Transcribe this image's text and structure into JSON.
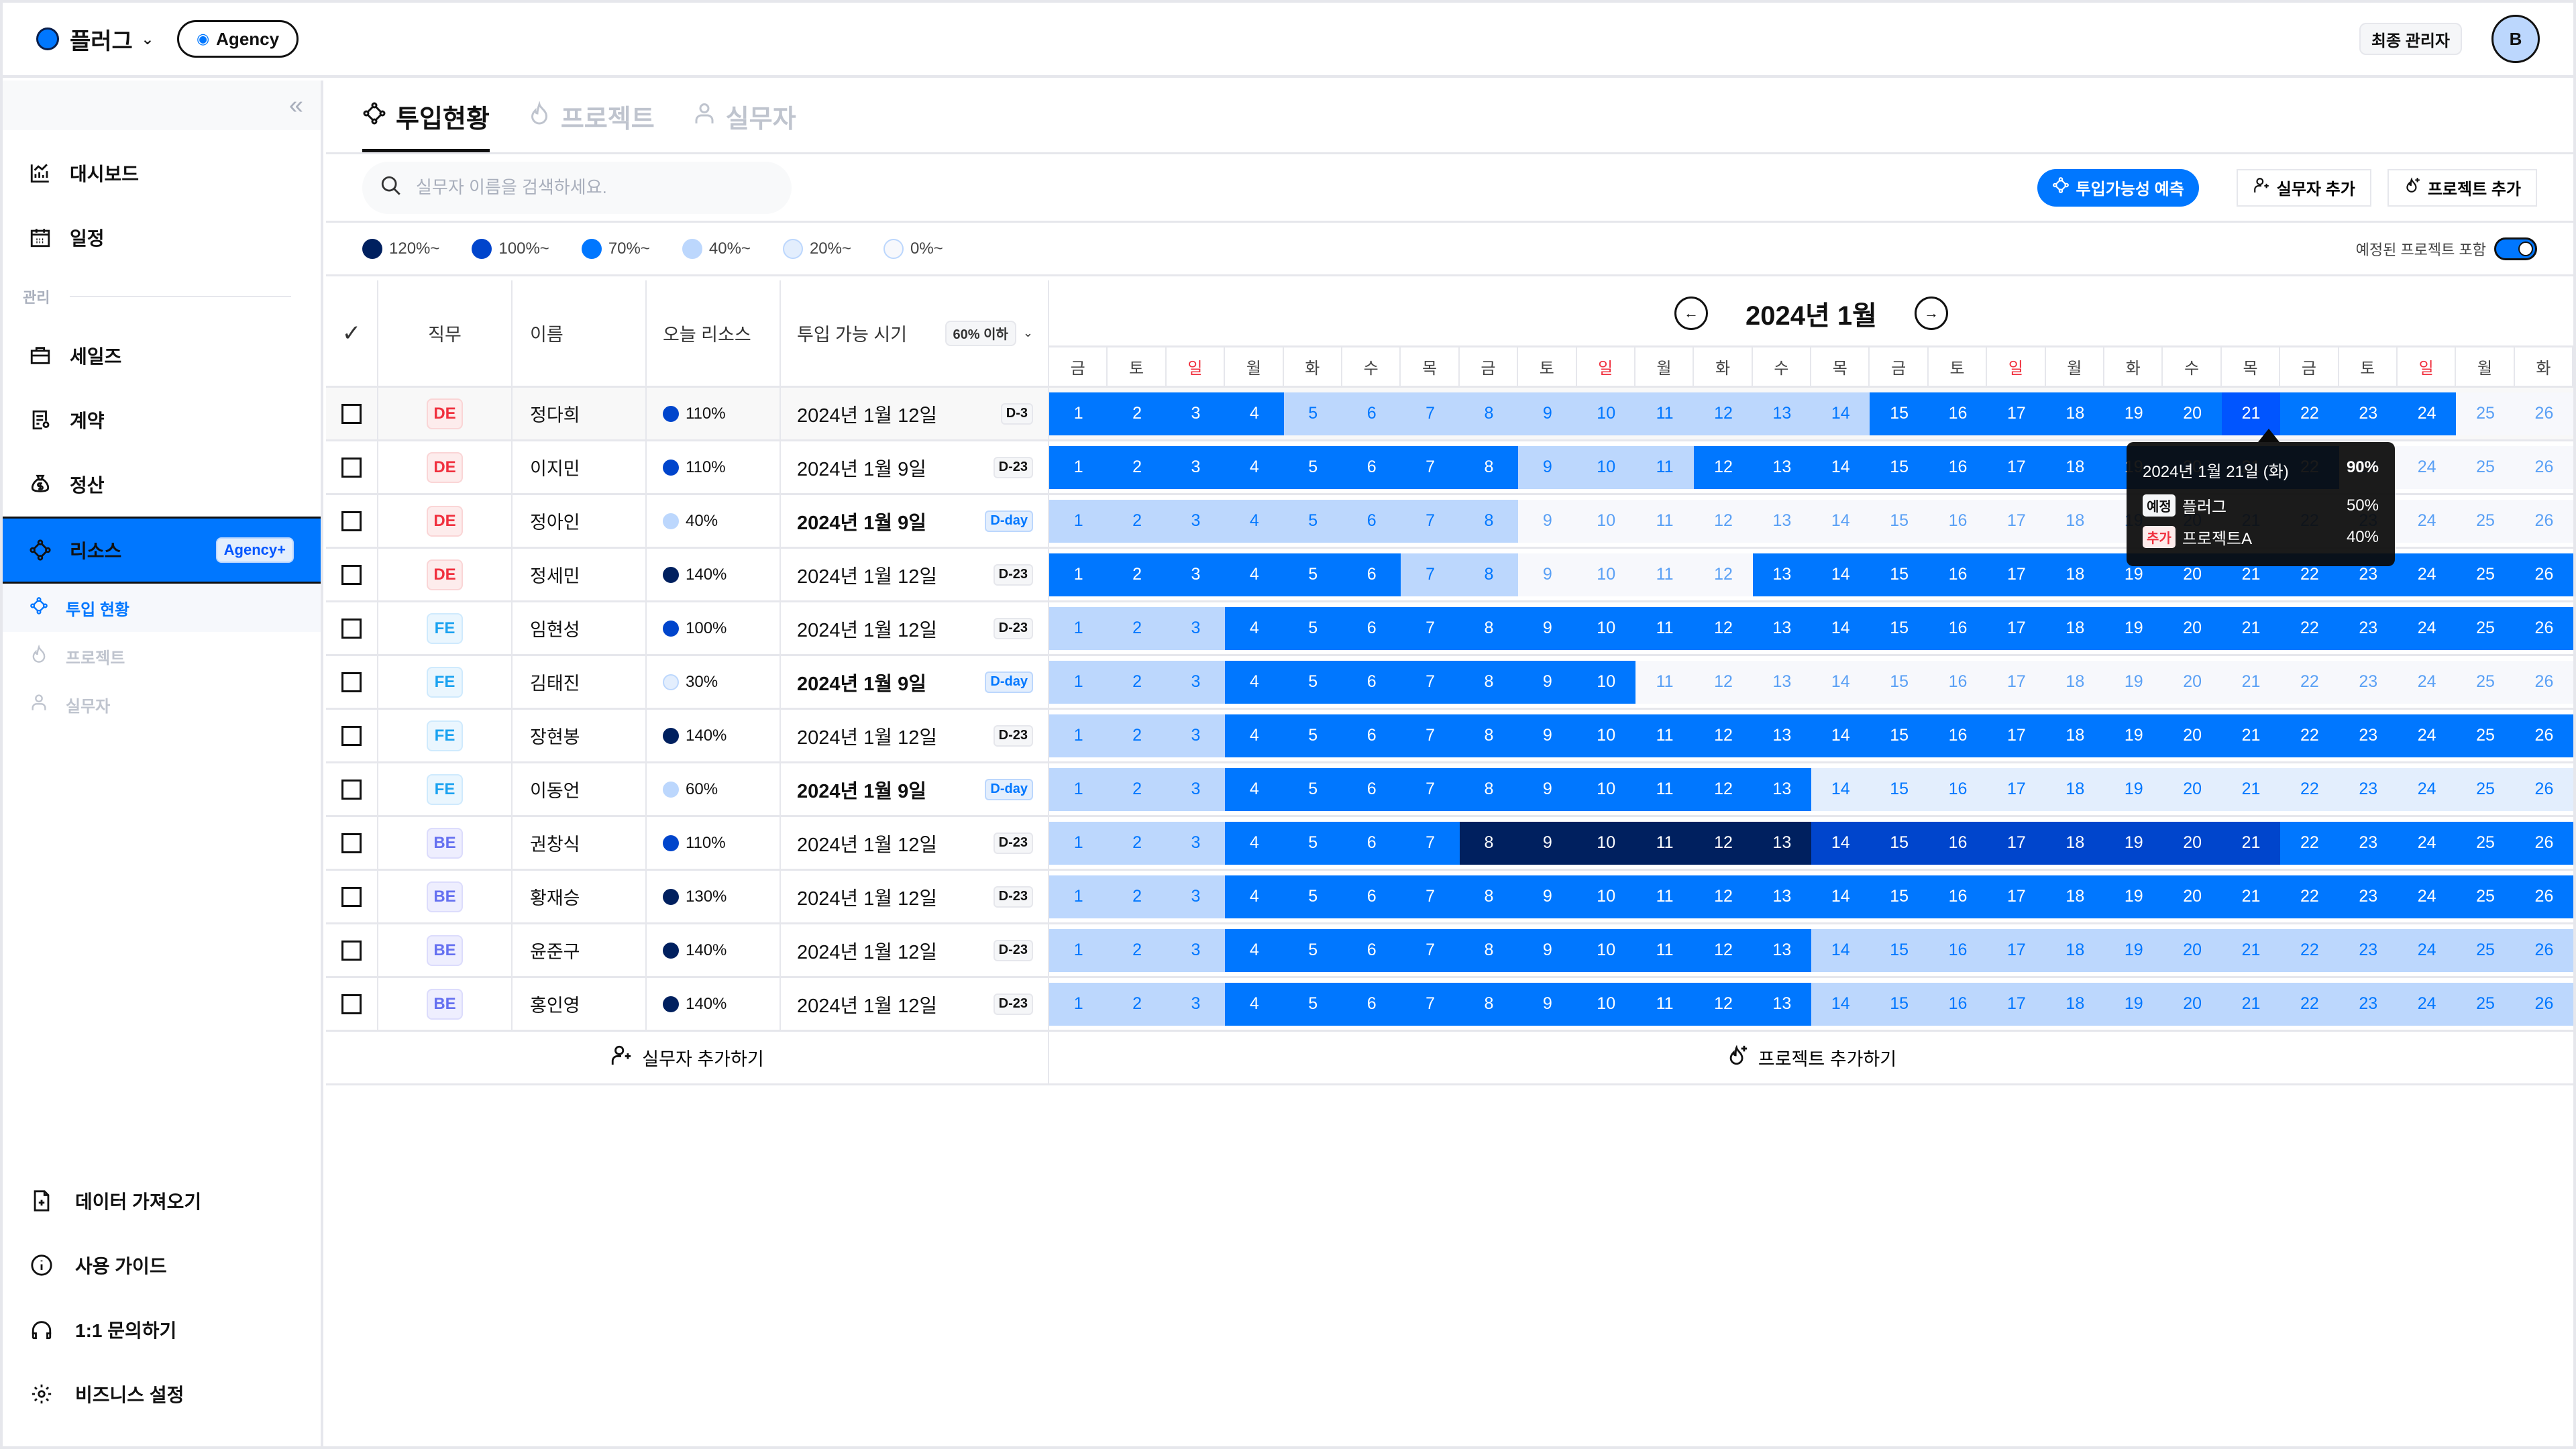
{
  "topbar": {
    "org_name": "플러그",
    "plan_badge": "Agency",
    "role": "최종 관리자",
    "avatar_initial": "B"
  },
  "sidebar": {
    "top_items": [
      {
        "label": "대시보드",
        "icon": "chart-icon"
      },
      {
        "label": "일정",
        "icon": "calendar-icon"
      }
    ],
    "section_label": "관리",
    "manage_items": [
      {
        "label": "세일즈",
        "icon": "briefcase-icon"
      },
      {
        "label": "계약",
        "icon": "contract-icon"
      },
      {
        "label": "정산",
        "icon": "money-bag-icon"
      }
    ],
    "active_item": {
      "label": "리소스",
      "badge": "Agency+"
    },
    "sub_items": [
      {
        "label": "투입 현황",
        "active": true
      },
      {
        "label": "프로젝트",
        "active": false
      },
      {
        "label": "실무자",
        "active": false
      }
    ],
    "bottom_items": [
      {
        "label": "데이터 가져오기",
        "icon": "file-plus-icon"
      },
      {
        "label": "사용 가이드",
        "icon": "info-icon"
      },
      {
        "label": "1:1 문의하기",
        "icon": "headset-icon"
      },
      {
        "label": "비즈니스 설정",
        "icon": "gear-icon"
      }
    ]
  },
  "tabs": [
    {
      "label": "투입현황",
      "active": true
    },
    {
      "label": "프로젝트",
      "active": false
    },
    {
      "label": "실무자",
      "active": false
    }
  ],
  "toolbar": {
    "search_placeholder": "실무자 이름을 검색하세요.",
    "search_value": "",
    "predict_label": "투입가능성 예측",
    "add_worker_label": "실무자 추가",
    "add_project_label": "프로젝트 추가"
  },
  "legend": [
    {
      "label": "120%~",
      "color": "#00205F"
    },
    {
      "label": "100%~",
      "color": "#0045CC"
    },
    {
      "label": "70%~",
      "color": "#0077FF"
    },
    {
      "label": "40%~",
      "color": "#BCD7FD"
    },
    {
      "label": "20%~",
      "color": "#E3EEFD"
    },
    {
      "label": "0%~",
      "color": "#F7F8FC"
    }
  ],
  "toggle": {
    "label": "예정된 프로젝트 포함",
    "on": true
  },
  "table": {
    "headers": {
      "role": "직무",
      "name": "이름",
      "today": "오늘 리소스",
      "available": "투입 가능 시기",
      "filter": "60% 이하"
    },
    "rows": [
      {
        "role": "DE",
        "name": "정다희",
        "today": "110%",
        "today_level": 4,
        "date": "2024년 1월 12일",
        "dchip": "D-3",
        "bold": false,
        "levels": [
          3,
          3,
          3,
          3,
          2,
          2,
          2,
          2,
          2,
          2,
          2,
          2,
          2,
          2,
          3,
          3,
          3,
          3,
          3,
          3,
          "H",
          3,
          3,
          3,
          0,
          0
        ]
      },
      {
        "role": "DE",
        "name": "이지민",
        "today": "110%",
        "today_level": 4,
        "date": "2024년 1월 9일",
        "dchip": "D-23",
        "bold": false,
        "levels": [
          3,
          3,
          3,
          3,
          3,
          3,
          3,
          3,
          2,
          2,
          2,
          3,
          3,
          3,
          3,
          3,
          3,
          3,
          3,
          3,
          3,
          3,
          0,
          0,
          0,
          0
        ]
      },
      {
        "role": "DE",
        "name": "정아인",
        "today": "40%",
        "today_level": 2,
        "date": "2024년 1월 9일",
        "dchip": "D-day",
        "bold": true,
        "levels": [
          2,
          2,
          2,
          2,
          2,
          2,
          2,
          2,
          0,
          0,
          0,
          0,
          0,
          0,
          0,
          0,
          0,
          0,
          0,
          0,
          0,
          0,
          0,
          0,
          0,
          0
        ]
      },
      {
        "role": "DE",
        "name": "정세민",
        "today": "140%",
        "today_level": 5,
        "date": "2024년 1월 12일",
        "dchip": "D-23",
        "bold": false,
        "levels": [
          3,
          3,
          3,
          3,
          3,
          3,
          2,
          2,
          0,
          0,
          0,
          0,
          3,
          3,
          3,
          3,
          3,
          3,
          3,
          3,
          3,
          3,
          3,
          3,
          3,
          3
        ]
      },
      {
        "role": "FE",
        "name": "임현성",
        "today": "100%",
        "today_level": 4,
        "date": "2024년 1월 12일",
        "dchip": "D-23",
        "bold": false,
        "levels": [
          2,
          2,
          2,
          3,
          3,
          3,
          3,
          3,
          3,
          3,
          3,
          3,
          3,
          3,
          3,
          3,
          3,
          3,
          3,
          3,
          3,
          3,
          3,
          3,
          3,
          3
        ]
      },
      {
        "role": "FE",
        "name": "김태진",
        "today": "30%",
        "today_level": 1,
        "date": "2024년 1월 9일",
        "dchip": "D-day",
        "bold": true,
        "levels": [
          2,
          2,
          2,
          3,
          3,
          3,
          3,
          3,
          3,
          3,
          0,
          0,
          0,
          0,
          0,
          0,
          0,
          0,
          0,
          0,
          0,
          0,
          0,
          0,
          0,
          0
        ]
      },
      {
        "role": "FE",
        "name": "장현봉",
        "today": "140%",
        "today_level": 5,
        "date": "2024년 1월 12일",
        "dchip": "D-23",
        "bold": false,
        "levels": [
          2,
          2,
          2,
          3,
          3,
          3,
          3,
          3,
          3,
          3,
          3,
          3,
          3,
          3,
          3,
          3,
          3,
          3,
          3,
          3,
          3,
          3,
          3,
          3,
          3,
          3
        ]
      },
      {
        "role": "FE",
        "name": "이동언",
        "today": "60%",
        "today_level": 2,
        "date": "2024년 1월 9일",
        "dchip": "D-day",
        "bold": true,
        "levels": [
          2,
          2,
          2,
          3,
          3,
          3,
          3,
          3,
          3,
          3,
          3,
          3,
          3,
          1,
          1,
          1,
          1,
          1,
          1,
          1,
          1,
          1,
          1,
          1,
          1,
          1
        ]
      },
      {
        "role": "BE",
        "name": "권창식",
        "today": "110%",
        "today_level": 4,
        "date": "2024년 1월 12일",
        "dchip": "D-23",
        "bold": false,
        "levels": [
          2,
          2,
          2,
          3,
          3,
          3,
          3,
          5,
          5,
          5,
          5,
          5,
          5,
          4,
          4,
          4,
          4,
          4,
          4,
          4,
          4,
          3,
          3,
          3,
          3,
          3
        ]
      },
      {
        "role": "BE",
        "name": "황재승",
        "today": "130%",
        "today_level": 5,
        "date": "2024년 1월 12일",
        "dchip": "D-23",
        "bold": false,
        "levels": [
          2,
          2,
          2,
          3,
          3,
          3,
          3,
          3,
          3,
          3,
          3,
          3,
          3,
          3,
          3,
          3,
          3,
          3,
          3,
          3,
          3,
          3,
          3,
          3,
          3,
          3
        ]
      },
      {
        "role": "BE",
        "name": "윤준구",
        "today": "140%",
        "today_level": 5,
        "date": "2024년 1월 12일",
        "dchip": "D-23",
        "bold": false,
        "levels": [
          2,
          2,
          2,
          3,
          3,
          3,
          3,
          3,
          3,
          3,
          3,
          3,
          3,
          2,
          2,
          2,
          2,
          2,
          2,
          2,
          2,
          2,
          2,
          2,
          2,
          2
        ]
      },
      {
        "role": "BE",
        "name": "홍인영",
        "today": "140%",
        "today_level": 5,
        "date": "2024년 1월 12일",
        "dchip": "D-23",
        "bold": false,
        "levels": [
          2,
          2,
          2,
          3,
          3,
          3,
          3,
          3,
          3,
          3,
          3,
          3,
          3,
          2,
          2,
          2,
          2,
          2,
          2,
          2,
          2,
          2,
          2,
          2,
          2,
          2
        ]
      }
    ],
    "add_worker_label": "실무자 추가하기",
    "add_project_label": "프로젝트 추가하기"
  },
  "calendar": {
    "title": "2024년 1월",
    "weekdays": [
      "금",
      "토",
      "일",
      "월",
      "화",
      "수",
      "목",
      "금",
      "토",
      "일",
      "월",
      "화",
      "수",
      "목",
      "금",
      "토",
      "일",
      "월",
      "화",
      "수",
      "목",
      "금",
      "토",
      "일",
      "월",
      "화"
    ],
    "days": [
      1,
      2,
      3,
      4,
      5,
      6,
      7,
      8,
      9,
      10,
      11,
      12,
      13,
      14,
      15,
      16,
      17,
      18,
      19,
      20,
      21,
      22,
      23,
      24,
      25,
      26
    ]
  },
  "tooltip": {
    "date": "2024년 1월 21일 (화)",
    "total": "90%",
    "lines": [
      {
        "tag": "예정",
        "tag_type": "planned",
        "project": "플러그",
        "pct": "50%"
      },
      {
        "tag": "추가",
        "tag_type": "added",
        "project": "프로젝트A",
        "pct": "40%"
      }
    ]
  }
}
